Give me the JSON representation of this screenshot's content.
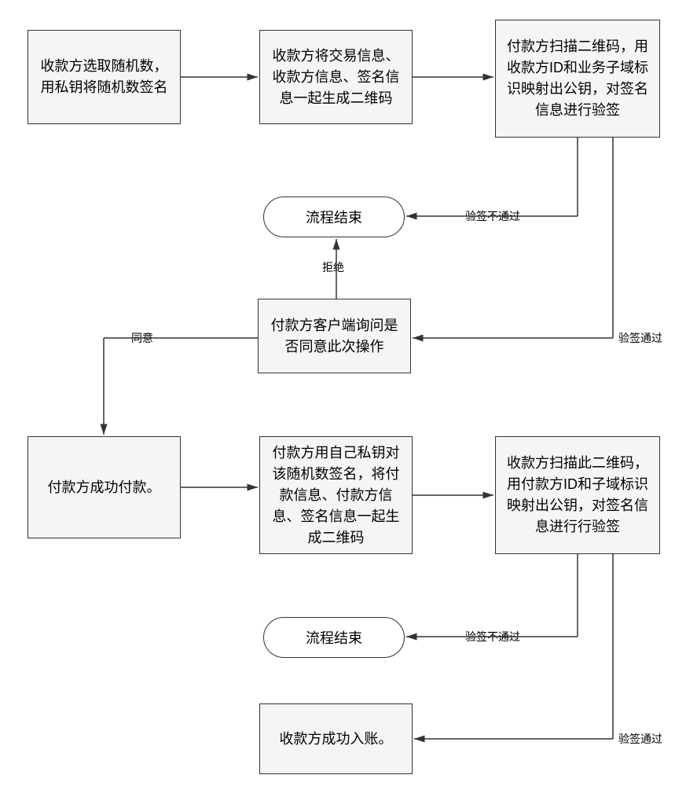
{
  "chart_data": {
    "type": "flowchart",
    "nodes": [
      {
        "id": "n1",
        "kind": "process",
        "text": "收款方选取随机数，用私钥将随机数签名"
      },
      {
        "id": "n2",
        "kind": "process",
        "text": "收款方将交易信息、收款方信息、签名信息一起生成二维码"
      },
      {
        "id": "n3",
        "kind": "process",
        "text": "付款方扫描二维码，用收款方ID和业务子域标识映射出公钥，对签名信息进行验签"
      },
      {
        "id": "t1",
        "kind": "terminator",
        "text": "流程结束"
      },
      {
        "id": "n4",
        "kind": "process",
        "text": "付款方客户端询问是否同意此次操作"
      },
      {
        "id": "n5",
        "kind": "process",
        "text": "付款方成功付款。"
      },
      {
        "id": "n6",
        "kind": "process",
        "text": "付款方用自己私钥对该随机数签名，将付款信息、付款方信息、签名信息一起生成二维码"
      },
      {
        "id": "n7",
        "kind": "process",
        "text": "收款方扫描此二维码，用付款方ID和子域标识映射出公钥，对签名信息进行行验签"
      },
      {
        "id": "t2",
        "kind": "terminator",
        "text": "流程结束"
      },
      {
        "id": "n8",
        "kind": "process",
        "text": "收款方成功入账。"
      }
    ],
    "edges": [
      {
        "from": "n1",
        "to": "n2",
        "label": ""
      },
      {
        "from": "n2",
        "to": "n3",
        "label": ""
      },
      {
        "from": "n3",
        "to": "t1",
        "label": "验签不通过"
      },
      {
        "from": "n3",
        "to": "n4",
        "label": "验签通过"
      },
      {
        "from": "n4",
        "to": "t1",
        "label": "拒绝"
      },
      {
        "from": "n4",
        "to": "n5",
        "label": "同意"
      },
      {
        "from": "n5",
        "to": "n6",
        "label": ""
      },
      {
        "from": "n6",
        "to": "n7",
        "label": ""
      },
      {
        "from": "n7",
        "to": "t2",
        "label": "验签不通过"
      },
      {
        "from": "n7",
        "to": "n8",
        "label": "验签通过"
      }
    ]
  },
  "nodes": {
    "n1": "收款方选取随机数，用私钥将随机数签名",
    "n2": "收款方将交易信息、收款方信息、签名信息一起生成二维码",
    "n3": "付款方扫描二维码，用收款方ID和业务子域标识映射出公钥，对签名信息进行验签",
    "t1": "流程结束",
    "n4": "付款方客户端询问是否同意此次操作",
    "n5": "付款方成功付款。",
    "n6": "付款方用自己私钥对该随机数签名，将付款信息、付款方信息、签名信息一起生成二维码",
    "n7": "收款方扫描此二维码，用付款方ID和子域标识映射出公钥，对签名信息进行行验签",
    "t2": "流程结束",
    "n8": "收款方成功入账。"
  },
  "labels": {
    "fail1": "验签不通过",
    "pass1": "验签通过",
    "reject": "拒绝",
    "agree": "同意",
    "fail2": "验签不通过",
    "pass2": "验签通过"
  }
}
